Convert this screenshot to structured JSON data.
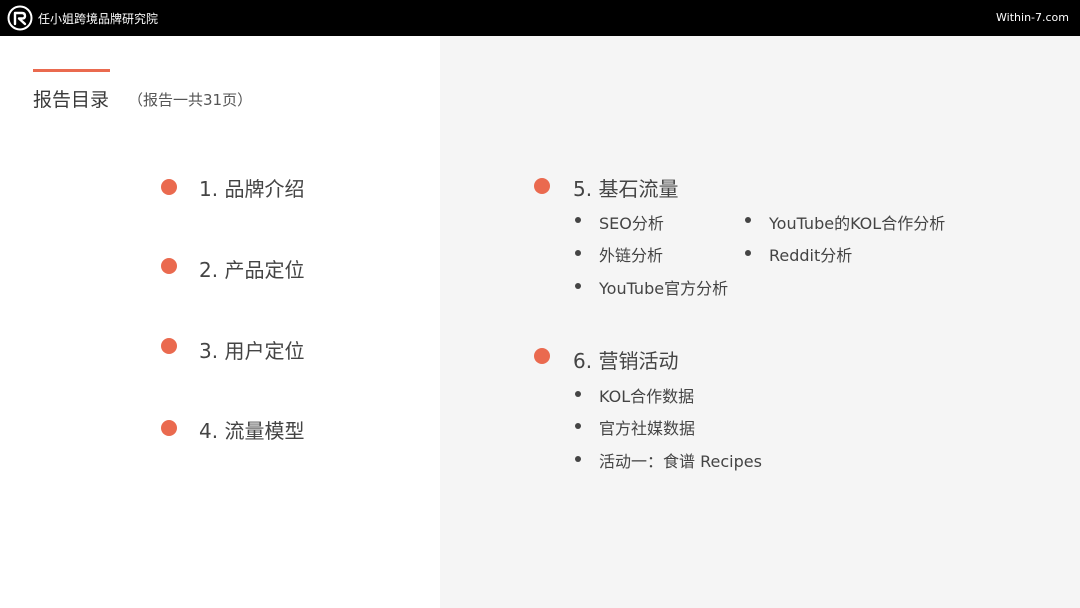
{
  "header": {
    "brand": "任小姐跨境品牌研究院",
    "site": "Within-7.com"
  },
  "colors": {
    "accent": "#ea6a4f",
    "topbar": "#000000",
    "panel": "#f5f5f5"
  },
  "title": "报告目录",
  "subtitle": "（报告一共31页）",
  "left_items": [
    "1. 品牌介绍",
    "2. 产品定位",
    "3. 用户定位",
    "4. 流量模型"
  ],
  "right_sections": [
    {
      "label": "5. 基石流量",
      "subitems": [
        "SEO分析",
        "YouTube的KOL合作分析",
        "外链分析",
        "Reddit分析",
        "YouTube官方分析"
      ]
    },
    {
      "label": "6. 营销活动",
      "subitems": [
        "KOL合作数据",
        "官方社媒数据",
        "活动一：食谱 Recipes"
      ]
    }
  ]
}
